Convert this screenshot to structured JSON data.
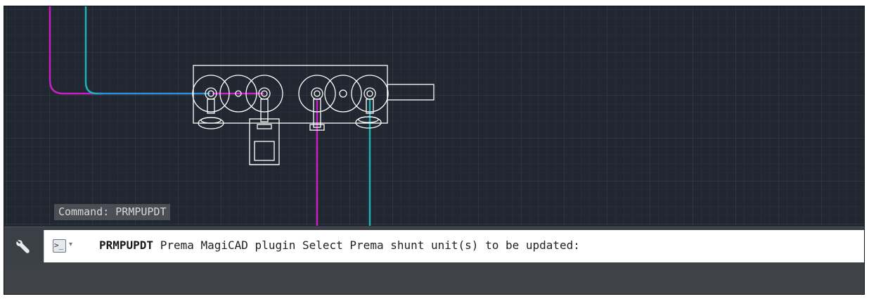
{
  "drawing": {
    "colors": {
      "background": "#212730",
      "grid_minor": "#2c323b",
      "grid_major": "#3a414c",
      "magenta_pipe": "#c71fc4",
      "cyan_pipe": "#1bb3b8",
      "blue_pipe": "#2e8fd6",
      "geometry": "#ffffff"
    }
  },
  "command_history": {
    "last_command": "Command: PRMPUPDT"
  },
  "command_line": {
    "customize_icon": "wrench-icon",
    "prompt_icon": "command-prompt-icon",
    "prompt_symbol": ">_",
    "dropdown_icon": "chevron-down-icon",
    "dropdown_glyph": "▾",
    "command_name": "PRMPUPDT",
    "prompt_message": " Prema MagiCAD plugin Select Prema shunt unit(s) to be updated:"
  }
}
